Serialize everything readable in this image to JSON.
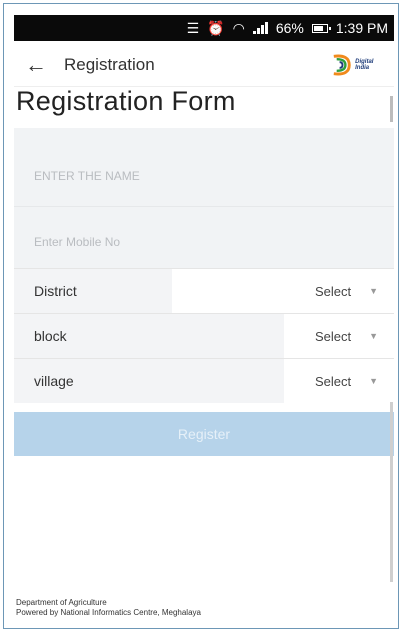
{
  "status_bar": {
    "battery": "66%",
    "time": "1:39 PM"
  },
  "app_bar": {
    "title": "Registration",
    "logo_text": "Digital India"
  },
  "form": {
    "title": "Registration Form",
    "name_placeholder": "ENTER THE NAME",
    "mobile_placeholder": "Enter Mobile No",
    "rows": [
      {
        "label": "District",
        "value": "Select"
      },
      {
        "label": "block",
        "value": "Select"
      },
      {
        "label": "village",
        "value": "Select"
      }
    ],
    "register_label": "Register"
  },
  "footer": {
    "line1": "Department of Agriculture",
    "line2": "Powered by National Informatics Centre, Meghalaya"
  },
  "colors": {
    "status_bar": "#0a0a0a",
    "register_button": "#b6d3ea",
    "form_background": "#f1f3f5"
  }
}
